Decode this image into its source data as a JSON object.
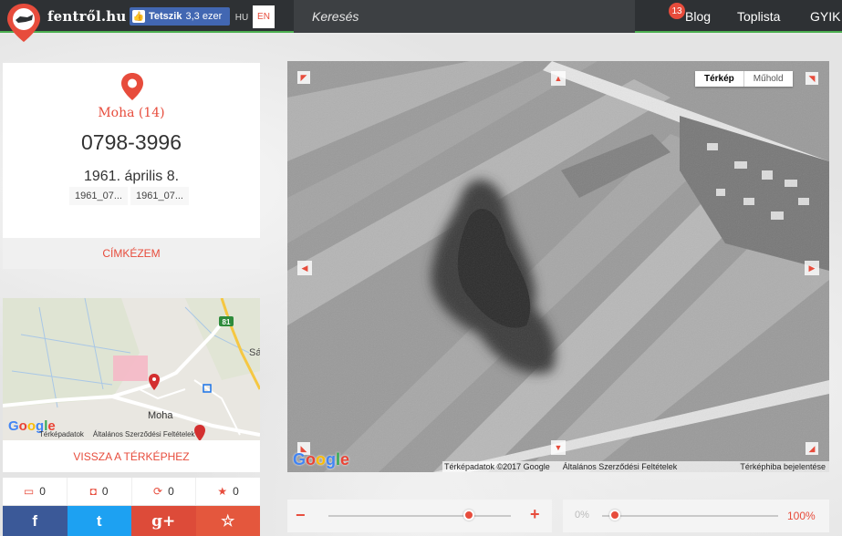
{
  "header": {
    "brand": "fentről.hu",
    "fb_like_label": "Tetszik",
    "fb_like_count": "3,3 ezer",
    "lang_hu": "HU",
    "lang_en": "EN",
    "search_placeholder": "Keresés",
    "nav": {
      "blog": "Blog",
      "toplist": "Toplista",
      "faq": "GYIK"
    },
    "notification_count": "13"
  },
  "photo": {
    "place": "Moha (14)",
    "id": "0798-3996",
    "date": "1961. április 8.",
    "tags": [
      "1961_07...",
      "1961_07..."
    ],
    "tag_button": "CÍMKÉZEM"
  },
  "mini_map": {
    "road_number": "81",
    "town_label": "Moha",
    "edge_label": "Sá",
    "google": "Google",
    "footer_data": "Térképadatok",
    "footer_terms": "Általános Szerződési Feltételek"
  },
  "back_button": "VISSZA A TÉRKÉPHEZ",
  "stats": {
    "comments": "0",
    "locations": "0",
    "shares": "0",
    "favorites": "0"
  },
  "share": {
    "facebook": "f",
    "twitter": "t",
    "googleplus": "g+",
    "favorite": "☆"
  },
  "main_map": {
    "maptype_map": "Térkép",
    "maptype_satellite": "Műhold",
    "google": "Google",
    "footer_data": "Térképadatok ©2017 Google",
    "footer_terms": "Általános Szerződési Feltételek",
    "footer_report": "Térképhiba bejelentése"
  },
  "zoom": {
    "minus": "−",
    "plus": "+",
    "level": 0.77
  },
  "opacity": {
    "min_label": "0%",
    "max_label": "100%",
    "value": 0.07
  },
  "colors": {
    "accent": "#e74c3c",
    "topbar": "#2e3134",
    "topbar_border": "#4caf50"
  }
}
